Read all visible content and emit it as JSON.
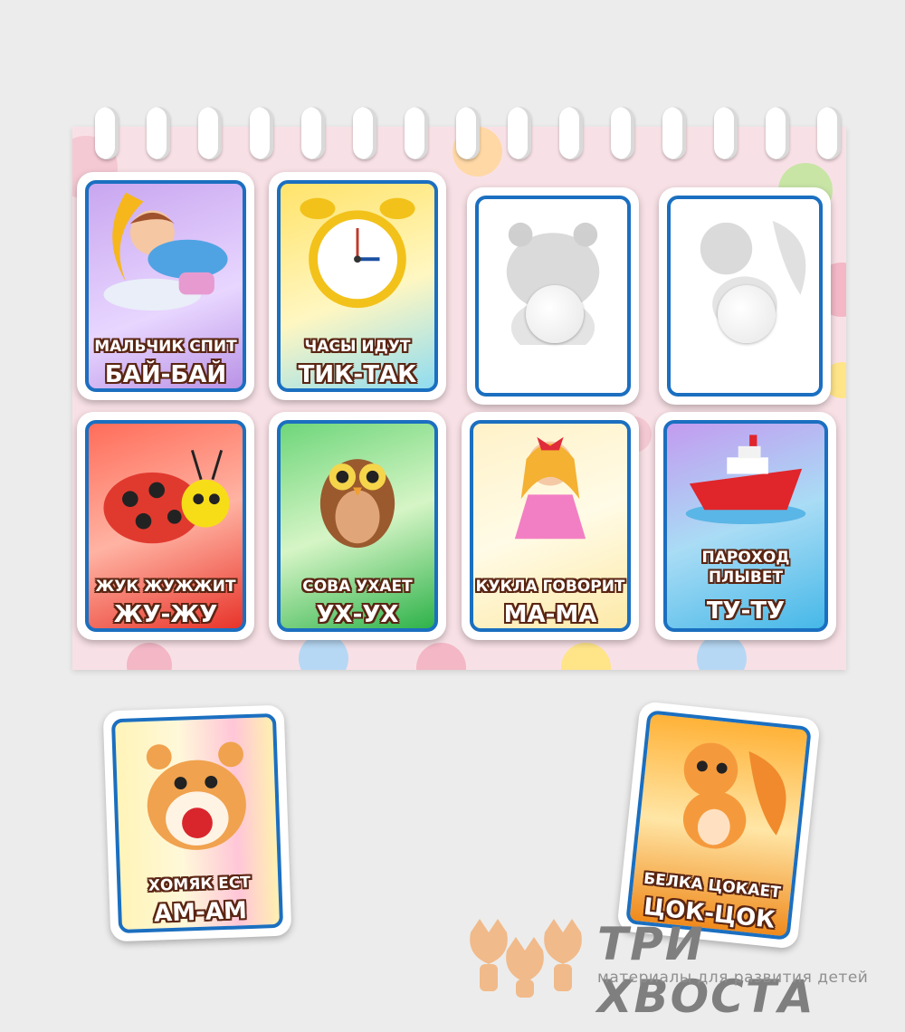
{
  "cards": {
    "boy": {
      "line1": "МАЛЬЧИК СПИТ",
      "line2": "БАЙ-БАЙ"
    },
    "clock": {
      "line1": "ЧАСЫ ИДУТ",
      "line2": "ТИК-ТАК"
    },
    "beetle": {
      "line1": "ЖУК ЖУЖЖИТ",
      "line2": "ЖУ-ЖУ"
    },
    "owl": {
      "line1": "СОВА УХАЕТ",
      "line2": "УХ-УХ"
    },
    "doll": {
      "line1": "КУКЛА ГОВОРИТ",
      "line2": "МА-МА"
    },
    "ship": {
      "line1": "ПАРОХОД",
      "line1b": "ПЛЫВЕТ",
      "line2": "ТУ-ТУ"
    },
    "hamster": {
      "line1": "ХОМЯК ЕСТ",
      "line2": "АМ-АМ"
    },
    "squirrel": {
      "line1": "БЕЛКА ЦОКАЕТ",
      "line2": "ЦОК-ЦОК"
    }
  },
  "brand": {
    "name": "ТРИ ХВОСТА",
    "tagline": "материалы для развития детей"
  },
  "colors": {
    "card_border": "#1b6fc0",
    "board_bg": "#f8e1e6",
    "caption_outline": "#5a2512"
  }
}
